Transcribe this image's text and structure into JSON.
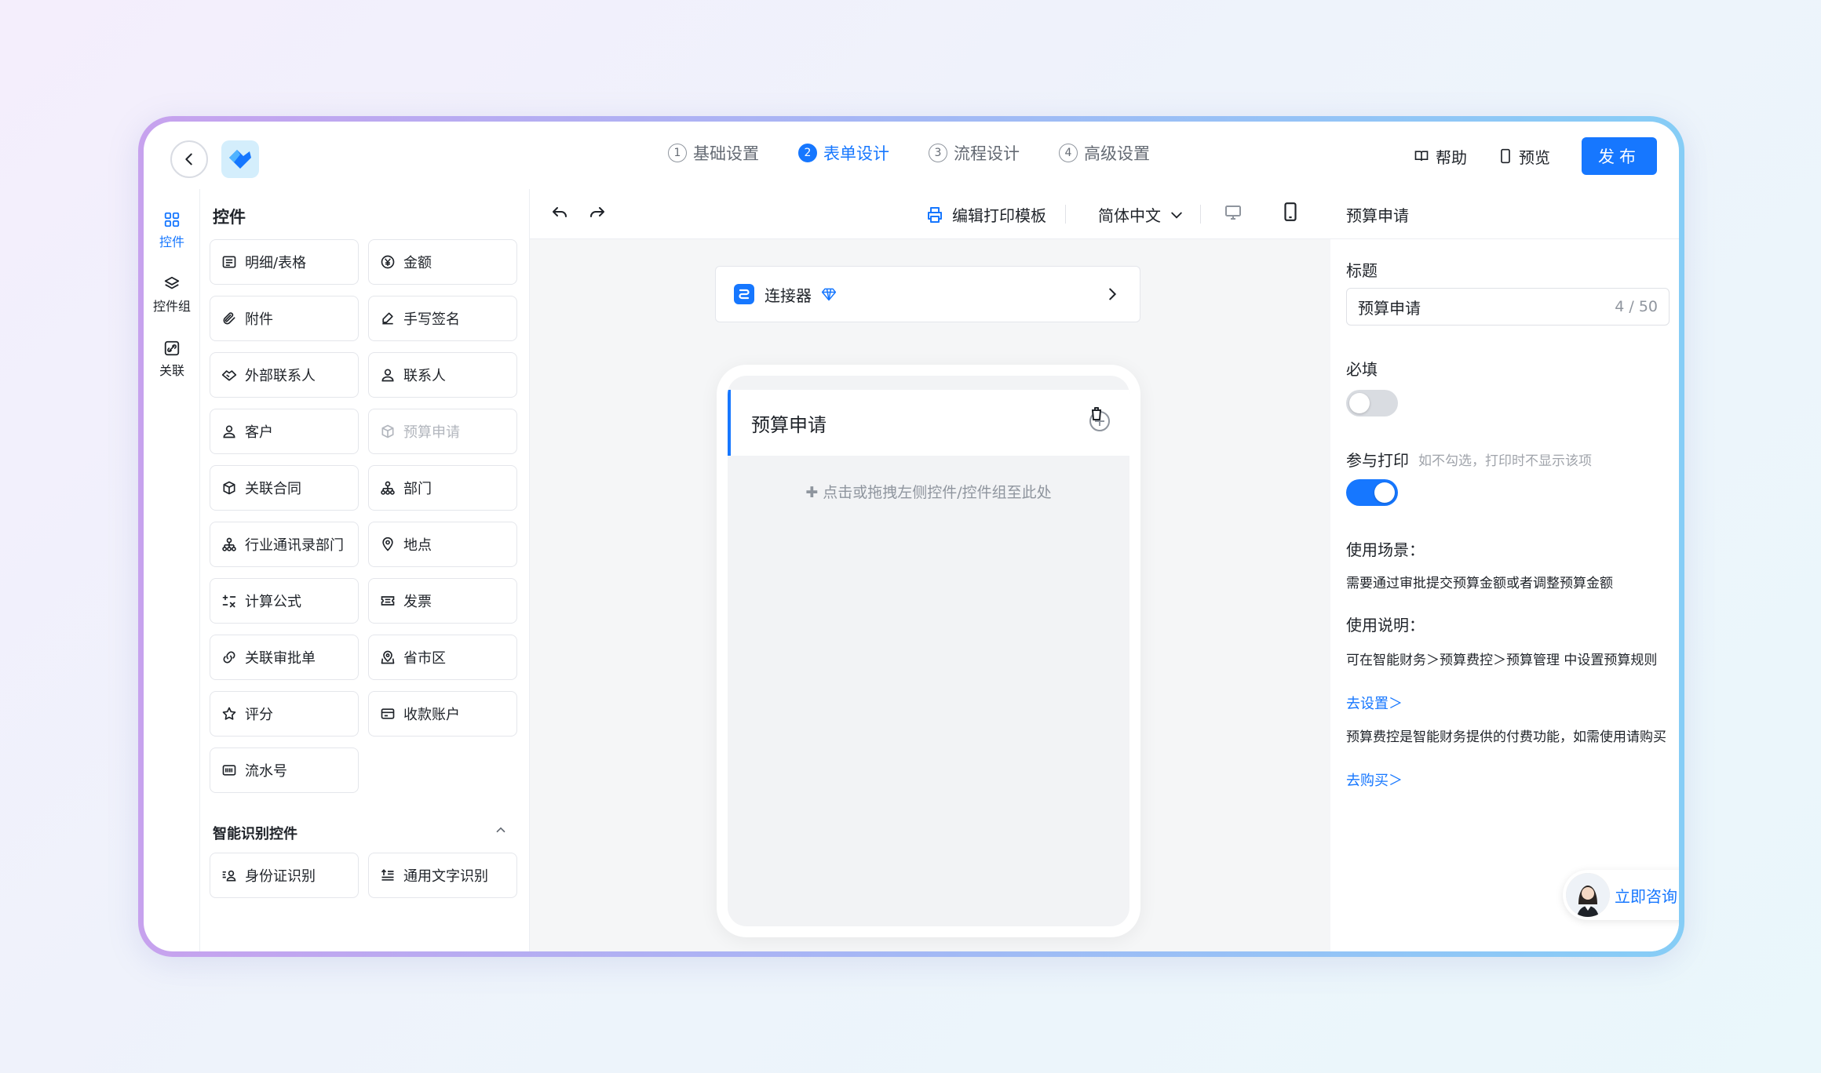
{
  "header": {
    "steps": [
      {
        "num": "1",
        "label": "基础设置"
      },
      {
        "num": "2",
        "label": "表单设计"
      },
      {
        "num": "3",
        "label": "流程设计"
      },
      {
        "num": "4",
        "label": "高级设置"
      }
    ],
    "active_step": 1,
    "help": "帮助",
    "preview": "预览",
    "publish": "发布"
  },
  "rail": {
    "items": [
      {
        "label": "控件"
      },
      {
        "label": "控件组"
      },
      {
        "label": "关联"
      }
    ]
  },
  "panel": {
    "title": "控件",
    "controls": [
      {
        "label": "明细/表格",
        "icon": "table-icon"
      },
      {
        "label": "金额",
        "icon": "yen-icon"
      },
      {
        "label": "附件",
        "icon": "paperclip-icon"
      },
      {
        "label": "手写签名",
        "icon": "signature-icon"
      },
      {
        "label": "外部联系人",
        "icon": "handshake-icon"
      },
      {
        "label": "联系人",
        "icon": "person-icon"
      },
      {
        "label": "客户",
        "icon": "customer-icon"
      },
      {
        "label": "预算申请",
        "icon": "box-icon"
      },
      {
        "label": "关联合同",
        "icon": "cube-icon"
      },
      {
        "label": "部门",
        "icon": "org-icon"
      },
      {
        "label": "行业通讯录部门",
        "icon": "org-icon"
      },
      {
        "label": "地点",
        "icon": "location-icon"
      },
      {
        "label": "计算公式",
        "icon": "formula-icon"
      },
      {
        "label": "发票",
        "icon": "ticket-icon"
      },
      {
        "label": "关联审批单",
        "icon": "link-icon"
      },
      {
        "label": "省市区",
        "icon": "map-icon"
      },
      {
        "label": "评分",
        "icon": "star-icon"
      },
      {
        "label": "收款账户",
        "icon": "card-icon"
      },
      {
        "label": "流水号",
        "icon": "barcode-icon"
      }
    ],
    "smart_section": {
      "title": "智能识别控件",
      "controls": [
        {
          "label": "身份证识别",
          "icon": "id-card-icon"
        },
        {
          "label": "通用文字识别",
          "icon": "text-scan-icon"
        }
      ]
    }
  },
  "toolbar": {
    "print": "编辑打印模板",
    "language": "简体中文"
  },
  "canvas": {
    "connector": "连接器",
    "field_title": "预算申请",
    "drop_hint": "点击或拖拽左侧控件/控件组至此处"
  },
  "props": {
    "header": "预算申请",
    "title_label": "标题",
    "title_value": "预算申请",
    "title_count": "4 / 50",
    "required_label": "必填",
    "required_on": false,
    "print_label": "参与打印",
    "print_hint": "如不勾选，打印时不显示该项",
    "print_on": true,
    "scene_label": "使用场景：",
    "scene_text": "需要通过审批提交预算金额或者调整预算金额",
    "usage_label": "使用说明：",
    "usage_text": "可在智能财务＞预算费控＞预算管理 中设置预算规则",
    "usage_link": "去设置＞",
    "purchase_text": "预算费控是智能财务提供的付费功能，如需使用请购买",
    "purchase_link": "去购买＞"
  },
  "consult": "立即咨询",
  "colors": {
    "accent": "#1677ff"
  }
}
